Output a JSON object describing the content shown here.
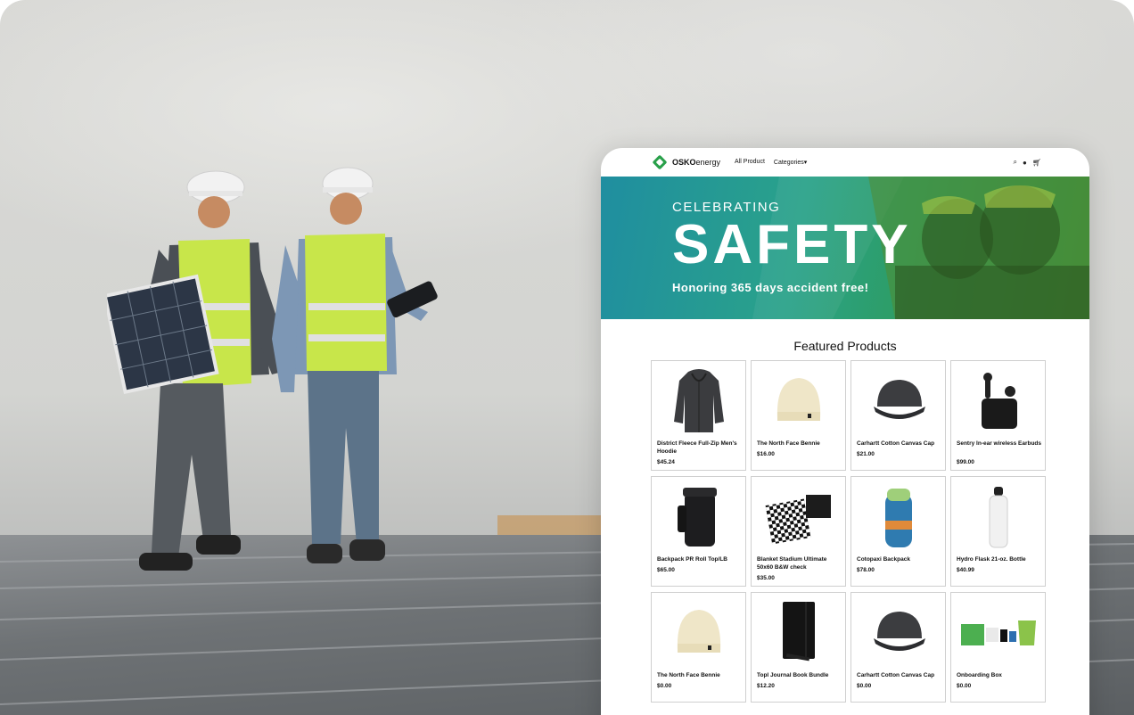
{
  "header": {
    "logo_bold": "OSKO",
    "logo_light": "energy",
    "nav": [
      "All Product",
      "Categories▾"
    ],
    "icons": [
      "search-icon",
      "user-icon",
      "cart-icon"
    ]
  },
  "hero": {
    "line1": "CELEBRATING",
    "line2": "SAFETY",
    "line3": "Honoring 365 days accident free!"
  },
  "featured_title": "Featured Products",
  "products": [
    {
      "name": "District Fleece Full-Zip Men's Hoodie",
      "price": "$45.24",
      "icon": "hoodie"
    },
    {
      "name": "The North Face Bennie",
      "price": "$16.00",
      "icon": "beanie"
    },
    {
      "name": "Carhartt Cotton Canvas Cap",
      "price": "$21.00",
      "icon": "cap"
    },
    {
      "name": "Sentry In-ear wireless Earbuds",
      "price": "$99.00",
      "icon": "earbuds"
    },
    {
      "name": "Backpack PR Roll Top/LB",
      "price": "$65.00",
      "icon": "backpack"
    },
    {
      "name": "Blanket Stadium Ultimate 50x60 B&W check",
      "price": "$35.00",
      "icon": "blanket"
    },
    {
      "name": "Cotopaxi Backpack",
      "price": "$78.00",
      "icon": "backpack-blue"
    },
    {
      "name": "Hydro Flask 21-oz. Bottle",
      "price": "$40.99",
      "icon": "bottle"
    },
    {
      "name": "The North Face Bennie",
      "price": "$0.00",
      "icon": "beanie"
    },
    {
      "name": "Topl Journal Book Bundle",
      "price": "$12.20",
      "icon": "journal"
    },
    {
      "name": "Carhartt Cotton Canvas Cap",
      "price": "$0.00",
      "icon": "cap"
    },
    {
      "name": "Onboarding Box",
      "price": "$0.00",
      "icon": "box"
    }
  ],
  "colors": {
    "brand_green": "#29a04a",
    "hero_teal": "#1f8ea0",
    "vest": "#c8e64a"
  }
}
